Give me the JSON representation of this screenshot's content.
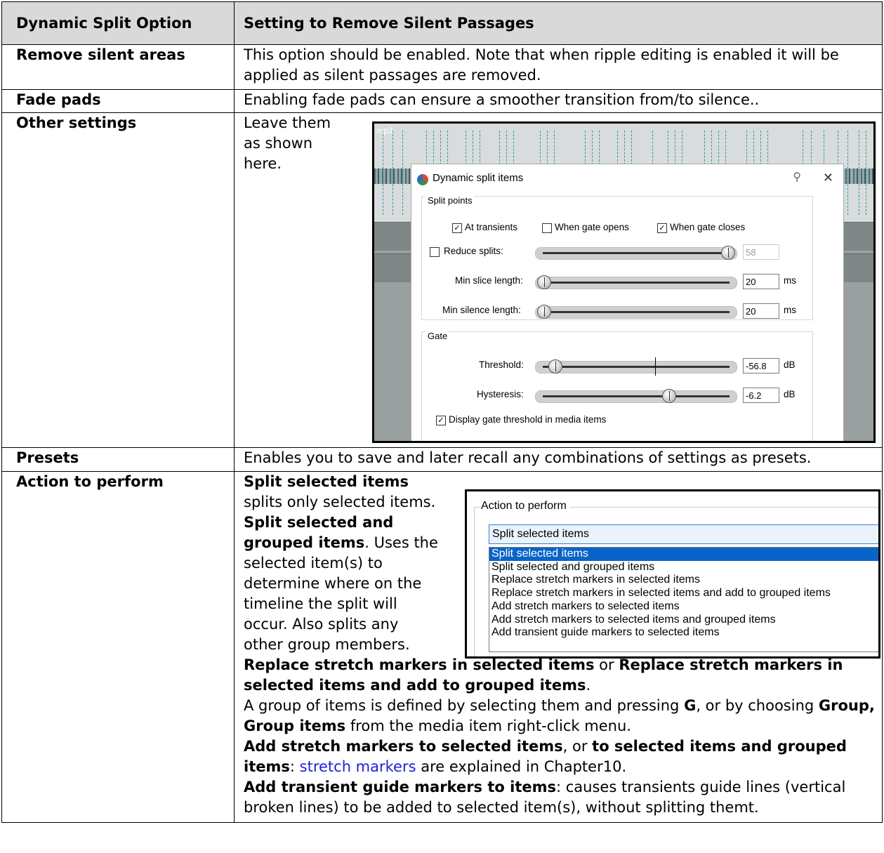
{
  "table": {
    "header": {
      "col1": "Dynamic Split Option",
      "col2": "Setting to Remove Silent Passages"
    },
    "rows": {
      "remove_silent": {
        "label": "Remove silent areas",
        "text": "This option should be enabled. Note that when ripple editing is enabled it will be applied as silent passages are removed."
      },
      "fade_pads": {
        "label": "Fade pads",
        "text": "Enabling fade pads can ensure a smoother transition from/to silence.."
      },
      "other": {
        "label": "Other settings",
        "text": "Leave them as shown here."
      },
      "presets": {
        "label": "Presets",
        "text": "Enables you to save and later recall any combinations of settings as presets."
      },
      "action": {
        "label": "Action to perform",
        "p1_bold": "Split selected items",
        "p1_text": "splits only selected items.",
        "p2_bold": "Split selected and grouped items",
        "p2_text": ". Uses the selected item(s) to determine where on the timeline the split will occur. Also splits any other group members.",
        "p3_bold_a": "Replace stretch markers in selected items",
        "p3_or": " or ",
        "p3_bold_b": "Replace stretch markers in selected items and add to grouped items",
        "p3_end": ".",
        "p4_a": "A group of items is defined by selecting them and pressing ",
        "p4_key": "G",
        "p4_b": ", or by choosing ",
        "p4_bold": "Group, Group items",
        "p4_c": " from the media item right-click menu.",
        "p5_bold_a": "Add stretch markers to selected items",
        "p5_or": ", or ",
        "p5_bold_b": "to selected items and grouped items",
        "p5_colon": ": ",
        "p5_link": "stretch markers",
        "p5_end": " are explained in Chapter10.",
        "p6_bold": "Add transient guide markers to items",
        "p6_text": ": causes transients guide lines (vertical broken lines) to be added to selected item(s), without splitting themt."
      }
    }
  },
  "dynamic_split": {
    "track_label": "mp3",
    "title": "Dynamic split items",
    "split_points_label": "Split points",
    "at_transients": "At transients",
    "at_transients_checked": "✓",
    "when_gate_opens": "When gate opens",
    "when_gate_closes": "When gate closes",
    "when_gate_closes_checked": "✓",
    "reduce_splits": "Reduce splits:",
    "reduce_splits_value": "58",
    "reduce_splits_level": 1.0,
    "min_slice_length": "Min slice length:",
    "min_slice_value": "20",
    "min_slice_unit": "ms",
    "min_slice_level": 0.0,
    "min_silence_length": "Min silence length:",
    "min_silence_value": "20",
    "min_silence_unit": "ms",
    "min_silence_level": 0.0,
    "gate_label": "Gate",
    "threshold": "Threshold:",
    "threshold_value": "-56.8",
    "threshold_unit": "dB",
    "threshold_level": 0.06,
    "threshold_marker_level": 0.6,
    "hysteresis": "Hysteresis:",
    "hysteresis_value": "-6.2",
    "hysteresis_unit": "dB",
    "hysteresis_level": 0.68,
    "display_gate": "Display gate threshold in media items",
    "display_gate_checked": "✓",
    "pin_icon": "pin-icon",
    "close_icon": "close-icon",
    "close_glyph": "✕",
    "pin_glyph": "⚲"
  },
  "action_to_perform": {
    "legend": "Action to perform",
    "selected": "Split selected items",
    "options": [
      "Split selected items",
      "Split selected and grouped items",
      "Replace stretch markers in selected items",
      "Replace stretch markers in selected items and add to grouped items",
      "Add stretch markers to selected items",
      "Add stretch markers to selected items and grouped items",
      "Add transient guide markers to selected items"
    ],
    "highlight_index": 0
  }
}
